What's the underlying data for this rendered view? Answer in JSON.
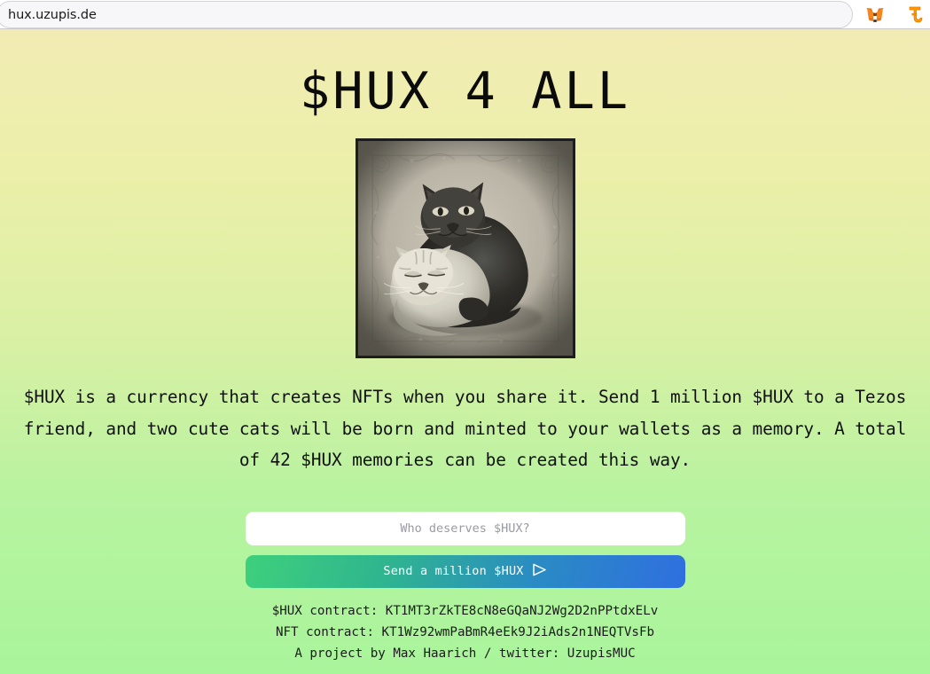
{
  "browser": {
    "url": "hux.uzupis.de",
    "extensions": [
      {
        "name": "metamask-extension-icon",
        "label": "MetaMask"
      },
      {
        "name": "temple-wallet-extension-icon",
        "label": "Temple Wallet"
      }
    ]
  },
  "page": {
    "title": "$HUX 4 ALL",
    "hero_image_alt": "Two cats cuddling, vintage black and white photograph in an ornate frame",
    "intro": "$HUX is a currency that creates NFTs when you share it. Send 1 million $HUX to a Tezos friend, and two cute cats will be born and minted to your wallets as a memory. A total of 42 $HUX memories can be created this way.",
    "form": {
      "recipient_placeholder": "Who deserves $HUX?",
      "recipient_value": "",
      "submit_label": "Send a million $HUX",
      "submit_icon": "send-triangle-icon"
    },
    "footer": {
      "hux_contract": "$HUX contract: KT1MT3rZkTE8cN8eGQaNJ2Wg2D2nPPtdxELv",
      "nft_contract": "NFT contract: KT1Wz92wmPaBmR4eEk9J2iAds2n1NEQTVsFb",
      "credit": "A project by Max Haarich / twitter: UzupisMUC"
    }
  },
  "colors": {
    "background_top": "#f2ecb4",
    "background_bottom": "#a9f59b",
    "button_gradient_start": "#3ed07c",
    "button_gradient_end": "#2f6fe0",
    "text": "#111111",
    "input_background": "#ffffff"
  }
}
